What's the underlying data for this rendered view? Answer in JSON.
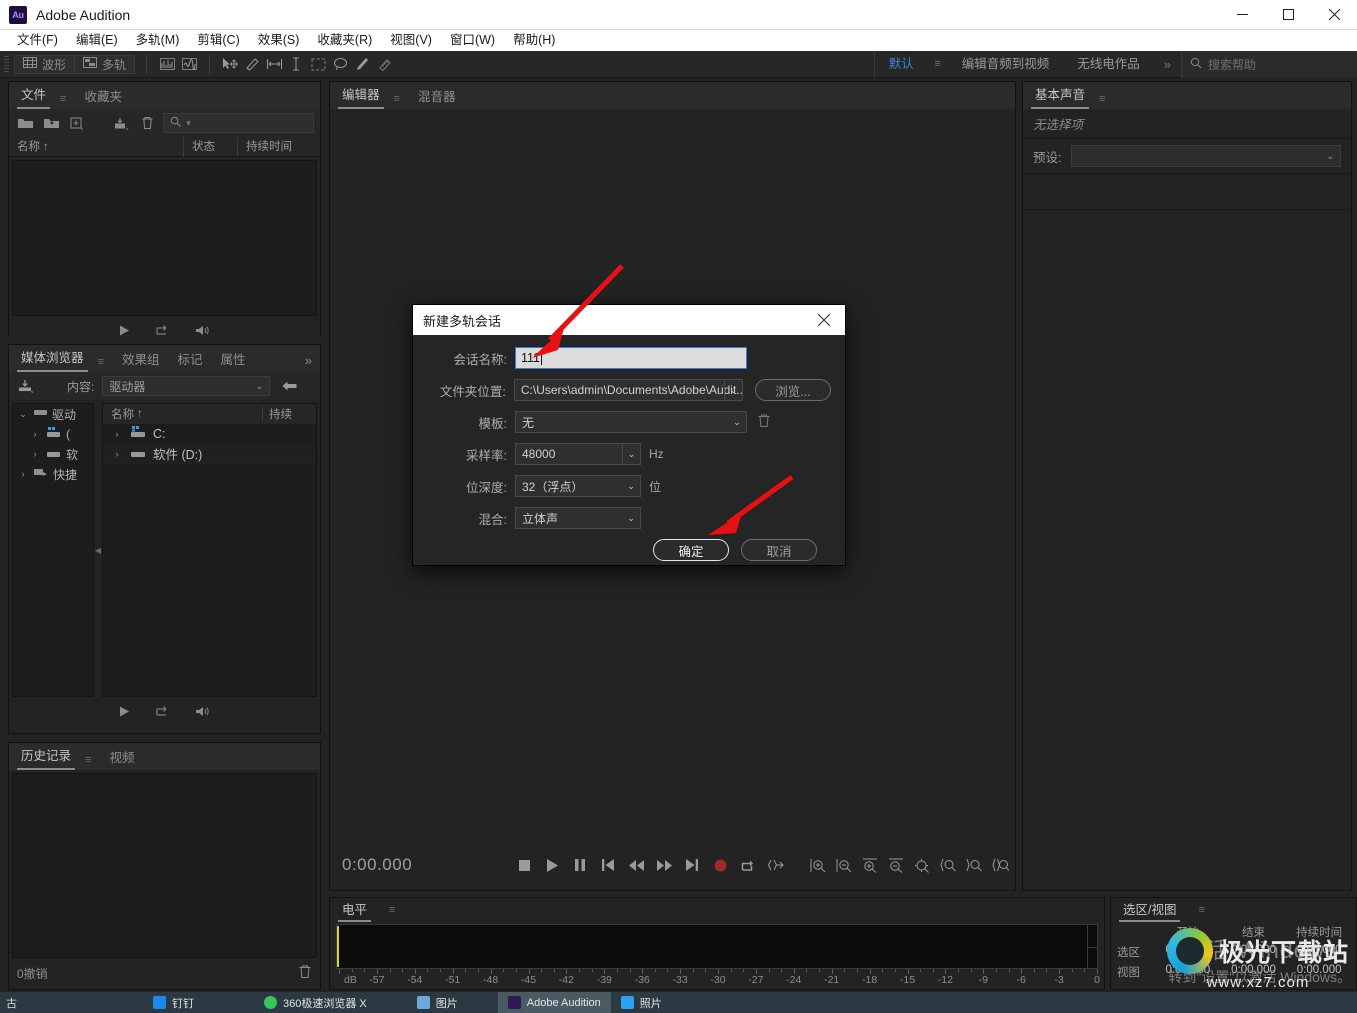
{
  "window": {
    "app_title": "Adobe Audition",
    "logo_text": "Au",
    "minimize": "—",
    "maximize": "☐",
    "close": "✕"
  },
  "menubar": {
    "items": [
      {
        "label": "文件(F)"
      },
      {
        "label": "编辑(E)"
      },
      {
        "label": "多轨(M)"
      },
      {
        "label": "剪辑(C)"
      },
      {
        "label": "效果(S)"
      },
      {
        "label": "收藏夹(R)"
      },
      {
        "label": "视图(V)"
      },
      {
        "label": "窗口(W)"
      },
      {
        "label": "帮助(H)"
      }
    ]
  },
  "toolbar": {
    "waveform_label": "波形",
    "multitrack_label": "多轨",
    "workspaces": [
      {
        "label": "默认",
        "active": true
      },
      {
        "label": "编辑音频到视频",
        "active": false
      },
      {
        "label": "无线电作品",
        "active": false
      }
    ],
    "more_label": "»",
    "help_placeholder": "搜索帮助"
  },
  "files_panel": {
    "tabs": [
      {
        "label": "文件",
        "active": true
      },
      {
        "label": "收藏夹",
        "active": false
      }
    ],
    "search_placeholder": "",
    "columns": [
      "名称",
      "状态",
      "持续时间"
    ],
    "sort_arrow": "↑",
    "rows": []
  },
  "media_panel": {
    "tabs": [
      {
        "label": "媒体浏览器",
        "active": true
      },
      {
        "label": "效果组",
        "active": false
      },
      {
        "label": "标记",
        "active": false
      },
      {
        "label": "属性",
        "active": false
      }
    ],
    "more_label": "»",
    "content_label": "内容:",
    "content_value": "驱动器",
    "tree": [
      {
        "label": "驱动",
        "indent": 0,
        "expander": "⌄",
        "icon": "drive-icon"
      },
      {
        "label": "(",
        "indent": 1,
        "expander": "›",
        "icon": "network-drive-icon"
      },
      {
        "label": "软",
        "indent": 1,
        "expander": "›",
        "icon": "drive-icon"
      },
      {
        "label": "快捷",
        "indent": 0,
        "expander": "›",
        "icon": "shortcut-icon"
      }
    ],
    "columns": [
      "名称",
      "持续"
    ],
    "sort_arrow": "↑",
    "rows": [
      {
        "name": "C:",
        "icon": "network-drive-icon"
      },
      {
        "name": "软件 (D:)",
        "icon": "drive-icon"
      }
    ]
  },
  "history_panel": {
    "tabs": [
      {
        "label": "历史记录",
        "active": true
      },
      {
        "label": "视频",
        "active": false
      }
    ],
    "status": "0撤销",
    "trash_icon": "trash-icon"
  },
  "editor_panel": {
    "tabs": [
      {
        "label": "编辑器",
        "active": true
      },
      {
        "label": "混音器",
        "active": false
      }
    ],
    "timecode": "0:00.000",
    "transport_buttons": [
      {
        "name": "stop",
        "glyph": "■"
      },
      {
        "name": "play",
        "glyph": "▶"
      },
      {
        "name": "pause",
        "glyph": "❚❚"
      },
      {
        "name": "move-to-start",
        "glyph": "|◀"
      },
      {
        "name": "rewind",
        "glyph": "◀◀"
      },
      {
        "name": "fast-forward",
        "glyph": "▶▶"
      },
      {
        "name": "move-to-end",
        "glyph": "▶|"
      },
      {
        "name": "record",
        "glyph": "●"
      },
      {
        "name": "loop",
        "glyph": "⤴"
      },
      {
        "name": "skip-selection",
        "glyph": "⇹"
      }
    ],
    "zoom_buttons": [
      {
        "name": "zoom-in-time",
        "glyph": "⌕+"
      },
      {
        "name": "zoom-out-time",
        "glyph": "⌕−"
      },
      {
        "name": "zoom-in-amplitude",
        "glyph": "⌕+"
      },
      {
        "name": "zoom-out-amplitude",
        "glyph": "⌕−"
      },
      {
        "name": "zoom-out-full",
        "glyph": "⌕"
      },
      {
        "name": "zoom-to-selection-in",
        "glyph": "⌕"
      },
      {
        "name": "zoom-to-selection-out",
        "glyph": "⌕"
      },
      {
        "name": "zoom-to-selection",
        "glyph": "⌕"
      }
    ]
  },
  "levels_panel": {
    "tabs": [
      {
        "label": "电平",
        "active": true
      }
    ],
    "db_label": "dB",
    "ticks": [
      -60,
      -57,
      -54,
      -51,
      -48,
      -45,
      -42,
      -39,
      -36,
      -33,
      -30,
      -27,
      -24,
      -21,
      -18,
      -15,
      -12,
      -9,
      -6,
      -3,
      0
    ],
    "tick_labels": [
      "-57",
      "-54",
      "-51",
      "-48",
      "-45",
      "-42",
      "-39",
      "-36",
      "-33",
      "-30",
      "-27",
      "-24",
      "-21",
      "-18",
      "-15",
      "-12",
      "-9",
      "-6",
      "-3",
      "0"
    ]
  },
  "essential_panel": {
    "tabs": [
      {
        "label": "基本声音",
        "active": true
      }
    ],
    "no_selection": "无选择项",
    "preset_label": "预设:",
    "preset_value": ""
  },
  "selview_panel": {
    "tabs": [
      {
        "label": "选区/视图",
        "active": true
      }
    ],
    "columns": [
      "",
      "开始",
      "结束",
      "持续时间"
    ],
    "rows": [
      {
        "label": "选区",
        "start": "0:00.000",
        "end": "0:00.000",
        "duration": "0:00.000"
      },
      {
        "label": "视图",
        "start": "0:00.000",
        "end": "0:00.000",
        "duration": "0:00.000"
      }
    ]
  },
  "dialog": {
    "title": "新建多轨会话",
    "close_glyph": "✕",
    "fields": {
      "session_name_label": "会话名称:",
      "session_name_value": "111",
      "folder_label": "文件夹位置:",
      "folder_value": "C:\\Users\\admin\\Documents\\Adobe\\Audit...",
      "browse_label": "浏览...",
      "template_label": "模板:",
      "template_value": "无",
      "samplerate_label": "采样率:",
      "samplerate_value": "48000",
      "samplerate_unit": "Hz",
      "bitdepth_label": "位深度:",
      "bitdepth_value": "32（浮点）",
      "bitdepth_unit": "位",
      "mix_label": "混合:",
      "mix_value": "立体声"
    },
    "ok_label": "确定",
    "cancel_label": "取消",
    "accent_color": "#2f7fd6"
  },
  "watermark": {
    "line1": "激活 Windows",
    "line2": "转到\"设置\"以激活 Windows。"
  },
  "sitemark": {
    "name": "极光下载站",
    "url": "www.xz7.com"
  },
  "taskbar": {
    "items": [
      {
        "label": "钉钉",
        "color": "#1b8ae8"
      },
      {
        "label": "360极速浏览器 X",
        "color": "#34c759"
      },
      {
        "label": "图片",
        "color": "#6fa8dc"
      },
      {
        "label": "Adobe Audition",
        "color": "#2b1a55",
        "active": true
      },
      {
        "label": "照片",
        "color": "#2aa3f0"
      }
    ]
  }
}
